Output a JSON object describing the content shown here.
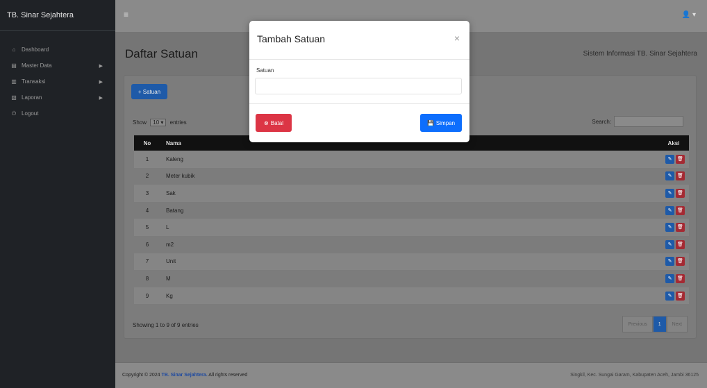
{
  "sidebar": {
    "brand": "TB. Sinar Sejahtera",
    "items": [
      {
        "icon": "dashboard-icon",
        "glyph": "⌂",
        "label": "Dashboard",
        "has_caret": false
      },
      {
        "icon": "database-icon",
        "glyph": "▤",
        "label": "Master Data",
        "has_caret": true
      },
      {
        "icon": "transaction-icon",
        "glyph": "▥",
        "label": "Transaksi",
        "has_caret": true
      },
      {
        "icon": "report-icon",
        "glyph": "▧",
        "label": "Laporan",
        "has_caret": true
      },
      {
        "icon": "logout-icon",
        "glyph": "⏻",
        "label": "Logout",
        "has_caret": false
      }
    ]
  },
  "topbar": {
    "menu_glyph": "≡",
    "user_glyph": "👤 ▾"
  },
  "page": {
    "title": "Daftar Satuan",
    "app_name": "Sistem Informasi TB. Sinar Sejahtera",
    "add_button": "+ Satuan",
    "show_entries": {
      "prefix": "Show",
      "value": "10",
      "suffix": "entries"
    },
    "search_label": "Search:",
    "table": {
      "columns": [
        "No",
        "Nama",
        "Aksi"
      ],
      "rows": [
        {
          "no": "1",
          "nama": "Kaleng"
        },
        {
          "no": "2",
          "nama": "Meter kubik"
        },
        {
          "no": "3",
          "nama": "Sak"
        },
        {
          "no": "4",
          "nama": "Batang"
        },
        {
          "no": "5",
          "nama": "L"
        },
        {
          "no": "6",
          "nama": "m2"
        },
        {
          "no": "7",
          "nama": "Unit"
        },
        {
          "no": "8",
          "nama": "M"
        },
        {
          "no": "9",
          "nama": "Kg"
        }
      ]
    },
    "info": "Showing 1 to 9 of 9 entries",
    "pager": {
      "previous": "Previous",
      "current": "1",
      "next": "Next"
    }
  },
  "footer": {
    "prefix": "Copyright © 2024 ",
    "brand": "TB. Sinar Sejahtera.",
    "suffix": " All rights reserved",
    "address": "Singkil, Kec. Sungai Garam, Kabupaten Aceh, Jambi 36125"
  },
  "modal": {
    "title": "Tambah Satuan",
    "close": "×",
    "field_label": "Satuan",
    "field_value": "",
    "cancel_label": "Batal",
    "save_label": "Simpan"
  },
  "colors": {
    "primary": "#0d6efd",
    "danger": "#dc3545",
    "sidebar": "#1f2226"
  }
}
